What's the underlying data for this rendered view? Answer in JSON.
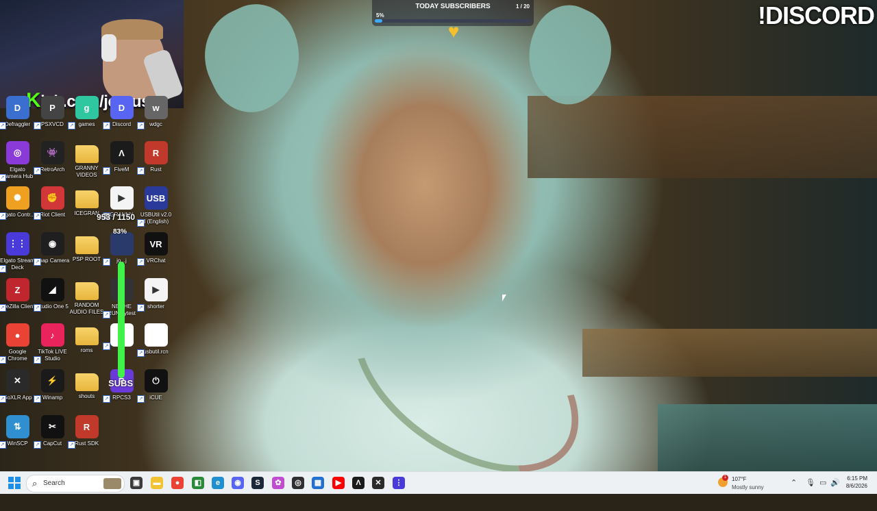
{
  "overlay": {
    "kick_prefix": "K",
    "kick_url": "ick.com/jcyrus",
    "discord_cta": "!DISCORD",
    "goal_title": "TODAY SUBSCRIBERS",
    "goal_percent": "5%",
    "goal_percent_value": 5,
    "goal_count": "1 / 20",
    "fps_readout": "953 / 1150",
    "meter_percent": "83%",
    "subs_word": "SUBS"
  },
  "desktop_icons": [
    {
      "label": "Defraggler",
      "color": "#3a6fd0",
      "glyph": "D"
    },
    {
      "label": "PSXVCD",
      "color": "#444",
      "glyph": "P"
    },
    {
      "label": "games",
      "color": "#2fc7a0",
      "glyph": "g"
    },
    {
      "label": "Discord",
      "color": "#5865f2",
      "glyph": "D"
    },
    {
      "label": "wdgc",
      "color": "#666",
      "glyph": "w"
    },
    {
      "label": "Elgato Camera Hub",
      "color": "#8a3ad9",
      "glyph": "◎"
    },
    {
      "label": "RetroArch",
      "color": "#222",
      "glyph": "👾"
    },
    {
      "label": "GRANNY VIDEOS",
      "color": "folder",
      "glyph": ""
    },
    {
      "label": "FiveM",
      "color": "#1b1b1b",
      "glyph": "Λ"
    },
    {
      "label": "Rust",
      "color": "#c0392b",
      "glyph": "R"
    },
    {
      "label": "Elgato Contr...",
      "color": "#f0a020",
      "glyph": "✺"
    },
    {
      "label": "Riot Client",
      "color": "#d13639",
      "glyph": "✊"
    },
    {
      "label": "ICEGRAN",
      "color": "folder",
      "glyph": ""
    },
    {
      "label": "GRANNY",
      "color": "#f4f4f4",
      "glyph": "▶"
    },
    {
      "label": "USBUtil v2.0 ll (English)",
      "color": "#2a3a9a",
      "glyph": "USB"
    },
    {
      "label": "Elgato Stream Deck",
      "color": "#4a3ad9",
      "glyph": "⋮⋮"
    },
    {
      "label": "Snap Camera",
      "color": "#1f1f1f",
      "glyph": "◉"
    },
    {
      "label": "PSP ROOT",
      "color": "folder",
      "glyph": ""
    },
    {
      "label": "jo...j",
      "color": "#2a3a6a",
      "glyph": ""
    },
    {
      "label": "VRChat",
      "color": "#111",
      "glyph": "VR"
    },
    {
      "label": "FileZilla Client",
      "color": "#c0262d",
      "glyph": "Z"
    },
    {
      "label": "Studio One 5",
      "color": "#111",
      "glyph": "◢"
    },
    {
      "label": "RANDOM AUDIO FILES",
      "color": "folder",
      "glyph": ""
    },
    {
      "label": "NB...HE RUN...ytest",
      "color": "#333",
      "glyph": "N"
    },
    {
      "label": "shorter",
      "color": "#f4f4f4",
      "glyph": "▶"
    },
    {
      "label": "Google Chrome",
      "color": "#ea4335",
      "glyph": "●"
    },
    {
      "label": "TikTok LIVE Studio",
      "color": "#e9245c",
      "glyph": "♪"
    },
    {
      "label": "roms",
      "color": "folder",
      "glyph": ""
    },
    {
      "label": "",
      "color": "#ffffff",
      "glyph": ""
    },
    {
      "label": "usbutil.rcn",
      "color": "#ffffff",
      "glyph": ""
    },
    {
      "label": "GoXLR App",
      "color": "#2a2a2a",
      "glyph": "✕"
    },
    {
      "label": "Winamp",
      "color": "#1a1a1a",
      "glyph": "⚡"
    },
    {
      "label": "shouts",
      "color": "folder",
      "glyph": ""
    },
    {
      "label": "RPCS3",
      "color": "#6a3ad9",
      "glyph": "R"
    },
    {
      "label": "iCUE",
      "color": "#111",
      "glyph": "⏻"
    },
    {
      "label": "WinSCP",
      "color": "#2f8fd0",
      "glyph": "⇅"
    },
    {
      "label": "CapCut",
      "color": "#111",
      "glyph": "✂"
    },
    {
      "label": "Rust SDK",
      "color": "#c0392b",
      "glyph": "R"
    }
  ],
  "taskbar": {
    "search_placeholder": "Search",
    "apps": [
      {
        "name": "task-view",
        "color": "#3b3b3b",
        "glyph": "▣"
      },
      {
        "name": "file-explorer",
        "color": "#f1c232",
        "glyph": "▬"
      },
      {
        "name": "chrome",
        "color": "#ea4335",
        "glyph": "●"
      },
      {
        "name": "app-green",
        "color": "#2a8a3a",
        "glyph": "◧"
      },
      {
        "name": "edge",
        "color": "#1f8fd0",
        "glyph": "e"
      },
      {
        "name": "discord",
        "color": "#5865f2",
        "glyph": "◉"
      },
      {
        "name": "steam",
        "color": "#1b2838",
        "glyph": "S"
      },
      {
        "name": "app-colorful",
        "color": "#c04cd0",
        "glyph": "✿"
      },
      {
        "name": "obs",
        "color": "#302e31",
        "glyph": "◎"
      },
      {
        "name": "store",
        "color": "#2470d0",
        "glyph": "▦"
      },
      {
        "name": "youtube",
        "color": "#ff0000",
        "glyph": "▶"
      },
      {
        "name": "fivem",
        "color": "#1b1b1b",
        "glyph": "Λ"
      },
      {
        "name": "goxlr",
        "color": "#2a2a2a",
        "glyph": "✕"
      },
      {
        "name": "stream-deck",
        "color": "#4a3ad9",
        "glyph": "⋮"
      }
    ],
    "weather_temp": "107°F",
    "weather_desc": "Mostly sunny",
    "weather_badge": "1",
    "time": "6:15 PM",
    "date": "8/6/2026"
  }
}
